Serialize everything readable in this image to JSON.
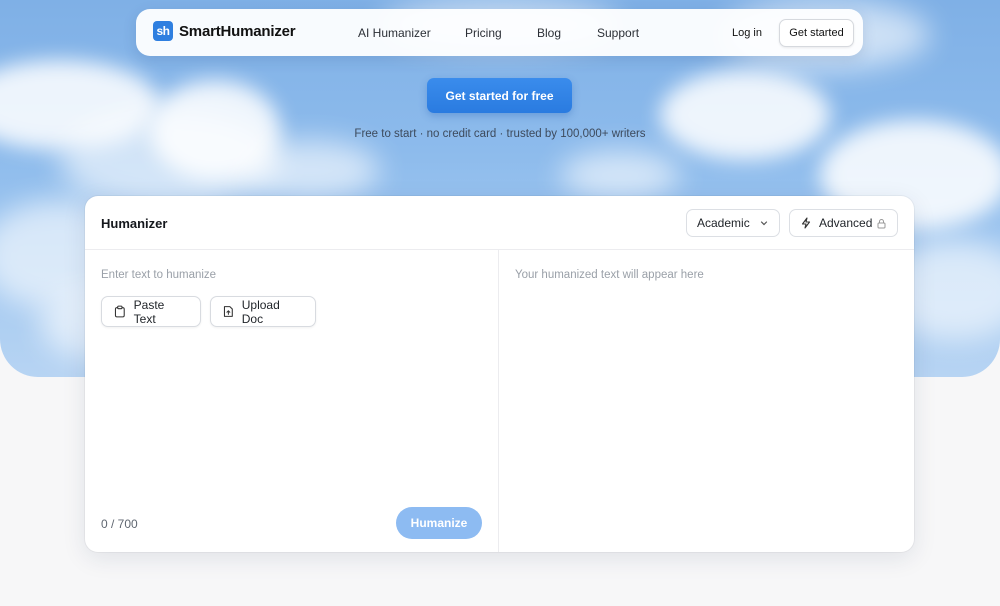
{
  "brand": {
    "logo_mark": "sh",
    "name": "SmartHumanizer"
  },
  "nav": {
    "links": [
      "AI Humanizer",
      "Pricing",
      "Blog",
      "Support"
    ],
    "login": "Log in",
    "cta": "Get started"
  },
  "hero": {
    "cta": "Get started for free",
    "tagline": "Free to start · no credit card · trusted by 100,000+ writers"
  },
  "humanizer": {
    "title": "Humanizer",
    "mode": {
      "selected": "Academic",
      "icon": "chevron-down-icon"
    },
    "advanced": {
      "label": "Advanced",
      "icons": [
        "bolt-icon",
        "lock-icon"
      ]
    },
    "input_placeholder": "Enter text to humanize",
    "output_placeholder": "Your humanized text will appear here",
    "paste_label": "Paste Text",
    "upload_label": "Upload Doc",
    "counter": "0 / 700",
    "submit_label": "Humanize"
  },
  "colors": {
    "accent": "#2f7fe0",
    "submit_disabled": "#8dbbf2",
    "background": "#f7f7f8"
  }
}
